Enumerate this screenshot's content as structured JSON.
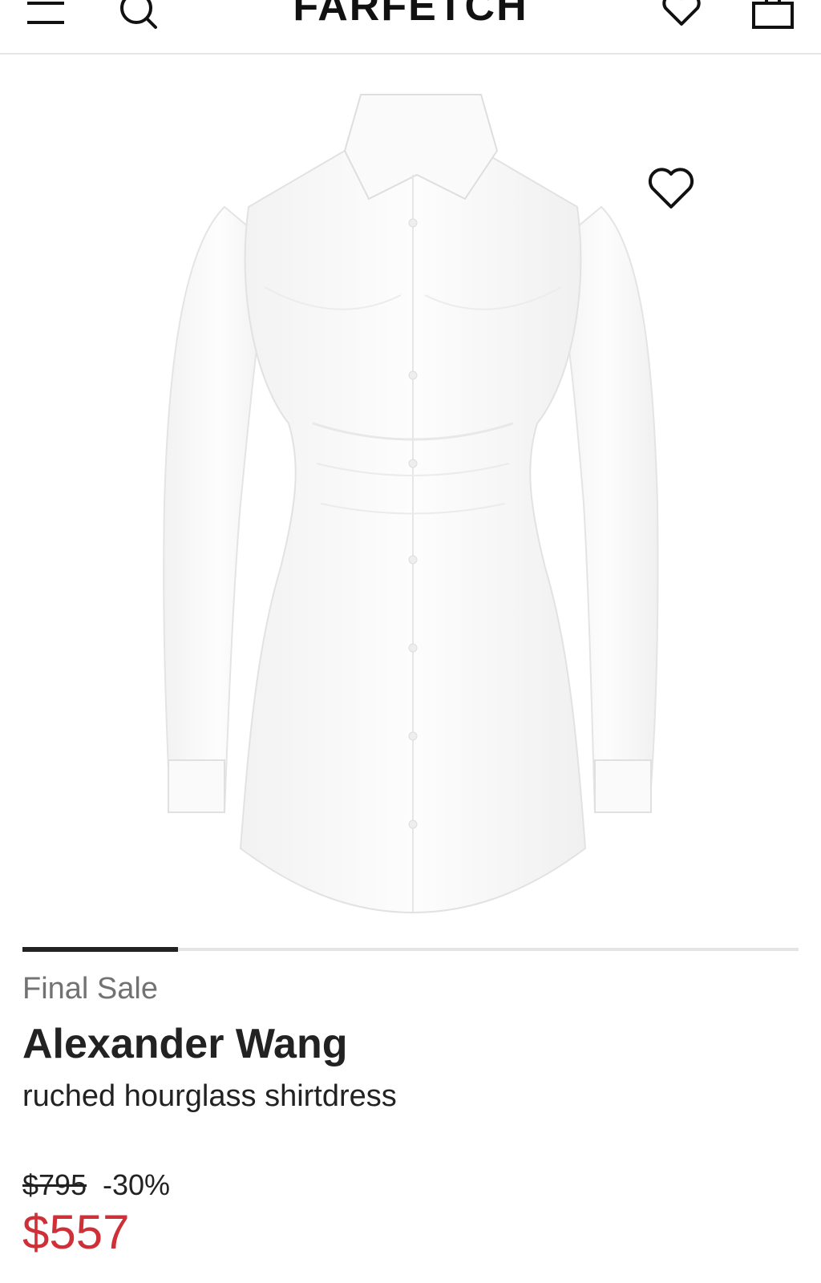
{
  "header": {
    "brand": "FARFETCH",
    "icons": [
      "menu-icon",
      "search-icon",
      "heart-icon",
      "bag-icon"
    ]
  },
  "gallery": {
    "image": "white ruched shirtdress",
    "favorite_icon": "heart-icon",
    "position": {
      "current": 1,
      "total": 5
    }
  },
  "product": {
    "sale_label": "Final Sale",
    "designer": "Alexander Wang",
    "description": "ruched hourglass shirtdress",
    "original_price": "$795",
    "discount": "-30%",
    "sale_price": "$557"
  },
  "colors": {
    "sale_price": "#cf3037",
    "text": "#222222",
    "muted": "#727272",
    "divider": "#e6e6e6"
  }
}
